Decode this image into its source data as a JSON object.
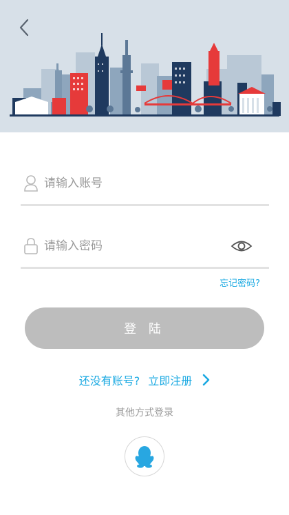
{
  "header": {
    "back_icon": "chevron-left-icon",
    "banner_art": "city-skyline-illustration"
  },
  "form": {
    "account_placeholder": "请输入账号",
    "account_icon": "user-icon",
    "password_placeholder": "请输入密码",
    "password_icon": "lock-icon",
    "toggle_visibility_icon": "eye-icon",
    "forgot_password": "忘记密码?",
    "login_button": "登 陆"
  },
  "register": {
    "question": "还没有账号?",
    "link": "立即注册",
    "icon": "chevron-right-icon"
  },
  "other_login": {
    "label": "其他方式登录",
    "qq_icon": "qq-penguin-icon"
  },
  "colors": {
    "accent": "#1aa9e2",
    "button_disabled": "#bdbdbd",
    "banner_bg": "#d7e0e8",
    "skyline_dark": "#1f3a5f",
    "skyline_red": "#e63a3a"
  }
}
